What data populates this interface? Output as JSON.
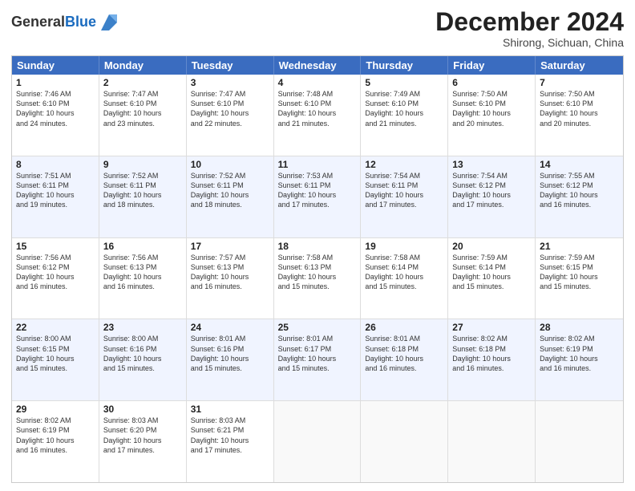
{
  "header": {
    "logo_line1": "General",
    "logo_line2": "Blue",
    "month": "December 2024",
    "location": "Shirong, Sichuan, China"
  },
  "days_of_week": [
    "Sunday",
    "Monday",
    "Tuesday",
    "Wednesday",
    "Thursday",
    "Friday",
    "Saturday"
  ],
  "weeks": [
    [
      {
        "day": "1",
        "lines": [
          "Sunrise: 7:46 AM",
          "Sunset: 6:10 PM",
          "Daylight: 10 hours",
          "and 24 minutes."
        ]
      },
      {
        "day": "2",
        "lines": [
          "Sunrise: 7:47 AM",
          "Sunset: 6:10 PM",
          "Daylight: 10 hours",
          "and 23 minutes."
        ]
      },
      {
        "day": "3",
        "lines": [
          "Sunrise: 7:47 AM",
          "Sunset: 6:10 PM",
          "Daylight: 10 hours",
          "and 22 minutes."
        ]
      },
      {
        "day": "4",
        "lines": [
          "Sunrise: 7:48 AM",
          "Sunset: 6:10 PM",
          "Daylight: 10 hours",
          "and 21 minutes."
        ]
      },
      {
        "day": "5",
        "lines": [
          "Sunrise: 7:49 AM",
          "Sunset: 6:10 PM",
          "Daylight: 10 hours",
          "and 21 minutes."
        ]
      },
      {
        "day": "6",
        "lines": [
          "Sunrise: 7:50 AM",
          "Sunset: 6:10 PM",
          "Daylight: 10 hours",
          "and 20 minutes."
        ]
      },
      {
        "day": "7",
        "lines": [
          "Sunrise: 7:50 AM",
          "Sunset: 6:10 PM",
          "Daylight: 10 hours",
          "and 20 minutes."
        ]
      }
    ],
    [
      {
        "day": "8",
        "lines": [
          "Sunrise: 7:51 AM",
          "Sunset: 6:11 PM",
          "Daylight: 10 hours",
          "and 19 minutes."
        ]
      },
      {
        "day": "9",
        "lines": [
          "Sunrise: 7:52 AM",
          "Sunset: 6:11 PM",
          "Daylight: 10 hours",
          "and 18 minutes."
        ]
      },
      {
        "day": "10",
        "lines": [
          "Sunrise: 7:52 AM",
          "Sunset: 6:11 PM",
          "Daylight: 10 hours",
          "and 18 minutes."
        ]
      },
      {
        "day": "11",
        "lines": [
          "Sunrise: 7:53 AM",
          "Sunset: 6:11 PM",
          "Daylight: 10 hours",
          "and 17 minutes."
        ]
      },
      {
        "day": "12",
        "lines": [
          "Sunrise: 7:54 AM",
          "Sunset: 6:11 PM",
          "Daylight: 10 hours",
          "and 17 minutes."
        ]
      },
      {
        "day": "13",
        "lines": [
          "Sunrise: 7:54 AM",
          "Sunset: 6:12 PM",
          "Daylight: 10 hours",
          "and 17 minutes."
        ]
      },
      {
        "day": "14",
        "lines": [
          "Sunrise: 7:55 AM",
          "Sunset: 6:12 PM",
          "Daylight: 10 hours",
          "and 16 minutes."
        ]
      }
    ],
    [
      {
        "day": "15",
        "lines": [
          "Sunrise: 7:56 AM",
          "Sunset: 6:12 PM",
          "Daylight: 10 hours",
          "and 16 minutes."
        ]
      },
      {
        "day": "16",
        "lines": [
          "Sunrise: 7:56 AM",
          "Sunset: 6:13 PM",
          "Daylight: 10 hours",
          "and 16 minutes."
        ]
      },
      {
        "day": "17",
        "lines": [
          "Sunrise: 7:57 AM",
          "Sunset: 6:13 PM",
          "Daylight: 10 hours",
          "and 16 minutes."
        ]
      },
      {
        "day": "18",
        "lines": [
          "Sunrise: 7:58 AM",
          "Sunset: 6:13 PM",
          "Daylight: 10 hours",
          "and 15 minutes."
        ]
      },
      {
        "day": "19",
        "lines": [
          "Sunrise: 7:58 AM",
          "Sunset: 6:14 PM",
          "Daylight: 10 hours",
          "and 15 minutes."
        ]
      },
      {
        "day": "20",
        "lines": [
          "Sunrise: 7:59 AM",
          "Sunset: 6:14 PM",
          "Daylight: 10 hours",
          "and 15 minutes."
        ]
      },
      {
        "day": "21",
        "lines": [
          "Sunrise: 7:59 AM",
          "Sunset: 6:15 PM",
          "Daylight: 10 hours",
          "and 15 minutes."
        ]
      }
    ],
    [
      {
        "day": "22",
        "lines": [
          "Sunrise: 8:00 AM",
          "Sunset: 6:15 PM",
          "Daylight: 10 hours",
          "and 15 minutes."
        ]
      },
      {
        "day": "23",
        "lines": [
          "Sunrise: 8:00 AM",
          "Sunset: 6:16 PM",
          "Daylight: 10 hours",
          "and 15 minutes."
        ]
      },
      {
        "day": "24",
        "lines": [
          "Sunrise: 8:01 AM",
          "Sunset: 6:16 PM",
          "Daylight: 10 hours",
          "and 15 minutes."
        ]
      },
      {
        "day": "25",
        "lines": [
          "Sunrise: 8:01 AM",
          "Sunset: 6:17 PM",
          "Daylight: 10 hours",
          "and 15 minutes."
        ]
      },
      {
        "day": "26",
        "lines": [
          "Sunrise: 8:01 AM",
          "Sunset: 6:18 PM",
          "Daylight: 10 hours",
          "and 16 minutes."
        ]
      },
      {
        "day": "27",
        "lines": [
          "Sunrise: 8:02 AM",
          "Sunset: 6:18 PM",
          "Daylight: 10 hours",
          "and 16 minutes."
        ]
      },
      {
        "day": "28",
        "lines": [
          "Sunrise: 8:02 AM",
          "Sunset: 6:19 PM",
          "Daylight: 10 hours",
          "and 16 minutes."
        ]
      }
    ],
    [
      {
        "day": "29",
        "lines": [
          "Sunrise: 8:02 AM",
          "Sunset: 6:19 PM",
          "Daylight: 10 hours",
          "and 16 minutes."
        ]
      },
      {
        "day": "30",
        "lines": [
          "Sunrise: 8:03 AM",
          "Sunset: 6:20 PM",
          "Daylight: 10 hours",
          "and 17 minutes."
        ]
      },
      {
        "day": "31",
        "lines": [
          "Sunrise: 8:03 AM",
          "Sunset: 6:21 PM",
          "Daylight: 10 hours",
          "and 17 minutes."
        ]
      },
      {
        "day": "",
        "lines": []
      },
      {
        "day": "",
        "lines": []
      },
      {
        "day": "",
        "lines": []
      },
      {
        "day": "",
        "lines": []
      }
    ]
  ]
}
